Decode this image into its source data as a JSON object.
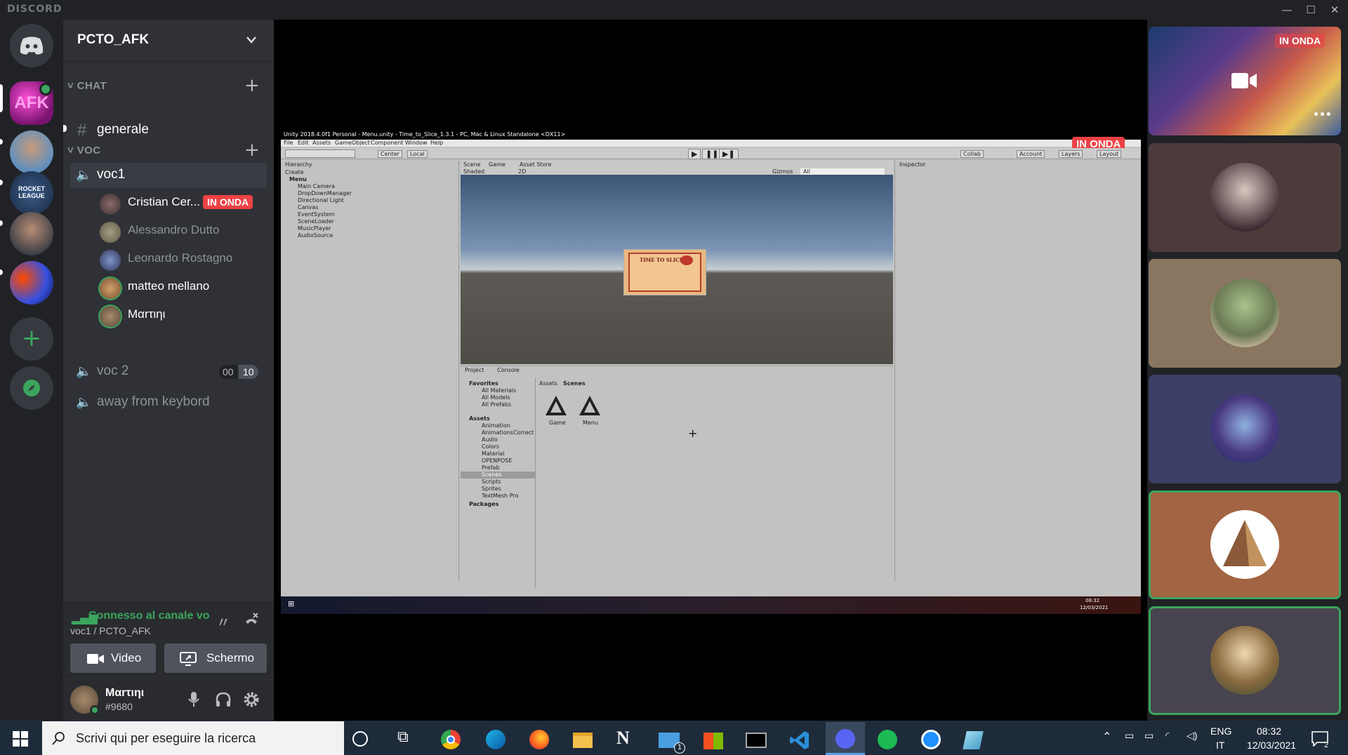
{
  "window": {
    "app_name": "DISCORD",
    "minimize": "—",
    "maximize": "☐",
    "close": "✕"
  },
  "servers": [
    {
      "name": "AFK"
    },
    {
      "name": "user"
    },
    {
      "name": "ROCKET LEAGUE"
    },
    {
      "name": "user2"
    },
    {
      "name": "galaxy"
    }
  ],
  "guild": {
    "name": "PCTO_AFK"
  },
  "categories": {
    "chat": "CHAT",
    "voc": "VOC"
  },
  "text_channels": [
    {
      "name": "generale"
    }
  ],
  "voice_channels": {
    "voc1": {
      "name": "voc1",
      "users": [
        {
          "name": "Cristian Cer...",
          "badge": "IN ONDA"
        },
        {
          "name": "Alessandro Dutto"
        },
        {
          "name": "Leonardo Rostagno"
        },
        {
          "name": "matteo mellano"
        },
        {
          "name": "Μαrτιηι"
        }
      ]
    },
    "voc2": {
      "name": "voc 2",
      "count_a": "00",
      "count_b": "10"
    },
    "away": {
      "name": "away from keybord"
    }
  },
  "voice_panel": {
    "status": "Connesso al canale vo",
    "channel": "voc1 / PCTO_AFK",
    "video_label": "Video",
    "screen_label": "Schermo"
  },
  "user": {
    "name": "Μαrτιηι",
    "tag": "#9680"
  },
  "stream": {
    "live_badge": "IN ONDA",
    "unity": {
      "title": "Unity 2018.4.0f1 Personal - Menu.unity - Time_to_Slice_1.3.1 - PC, Mac & Linux Standalone <DX11>",
      "menu": [
        "File",
        "Edit",
        "Assets",
        "GameObject",
        "Component",
        "Window",
        "Help"
      ],
      "toolbar": {
        "center": "Center",
        "local": "Local",
        "collab": "Collab",
        "account": "Account",
        "layers": "Layers",
        "layout": "Layout"
      },
      "hierarchy": {
        "tab": "Hierarchy",
        "create": "Create",
        "scene": "Menu",
        "items": [
          "Main Camera",
          "DropDownManager",
          "Directional Light",
          "Canvas",
          "EventSystem",
          "SceneLoader",
          "MusicPlayer",
          "AudioSource"
        ]
      },
      "scene_tabs": [
        "Scene",
        "Game",
        "Asset Store"
      ],
      "scene_opts": {
        "shaded": "Shaded",
        "mode2d": "2D",
        "gizmos": "Gizmos",
        "all": "All"
      },
      "card_title": "TIME TO SLICE",
      "inspector": "Inspector",
      "project_tabs": [
        "Project",
        "Console"
      ],
      "favorites": {
        "label": "Favorites",
        "items": [
          "All Materials",
          "All Models",
          "All Prefabs"
        ]
      },
      "assets": {
        "label": "Assets",
        "items": [
          "Animation",
          "AnimationsCorrect",
          "Audio",
          "Colors",
          "Material",
          "OPENPOSE",
          "Prefab",
          "Scenes",
          "Scripts",
          "Sprites",
          "TextMesh Pro"
        ]
      },
      "packages": "Packages",
      "breadcrumb": [
        "Assets",
        "Scenes"
      ],
      "scenes": [
        "Game",
        "Menu"
      ],
      "task_clock": "08:32",
      "task_date": "12/03/2021"
    }
  },
  "tiles": [
    {
      "badge": "IN ONDA",
      "more": "•••"
    },
    {},
    {},
    {},
    {},
    {}
  ],
  "taskbar": {
    "search_placeholder": "Scrivi qui per eseguire la ricerca",
    "lang_1": "ENG",
    "lang_2": "IT",
    "time": "08:32",
    "date": "12/03/2021",
    "notif_count": "2",
    "mail_badge": "1"
  },
  "colors": {
    "blurple": "#5865f2",
    "live": "#ed4245",
    "green": "#3ba55d",
    "speaking": "#3ba55d"
  }
}
